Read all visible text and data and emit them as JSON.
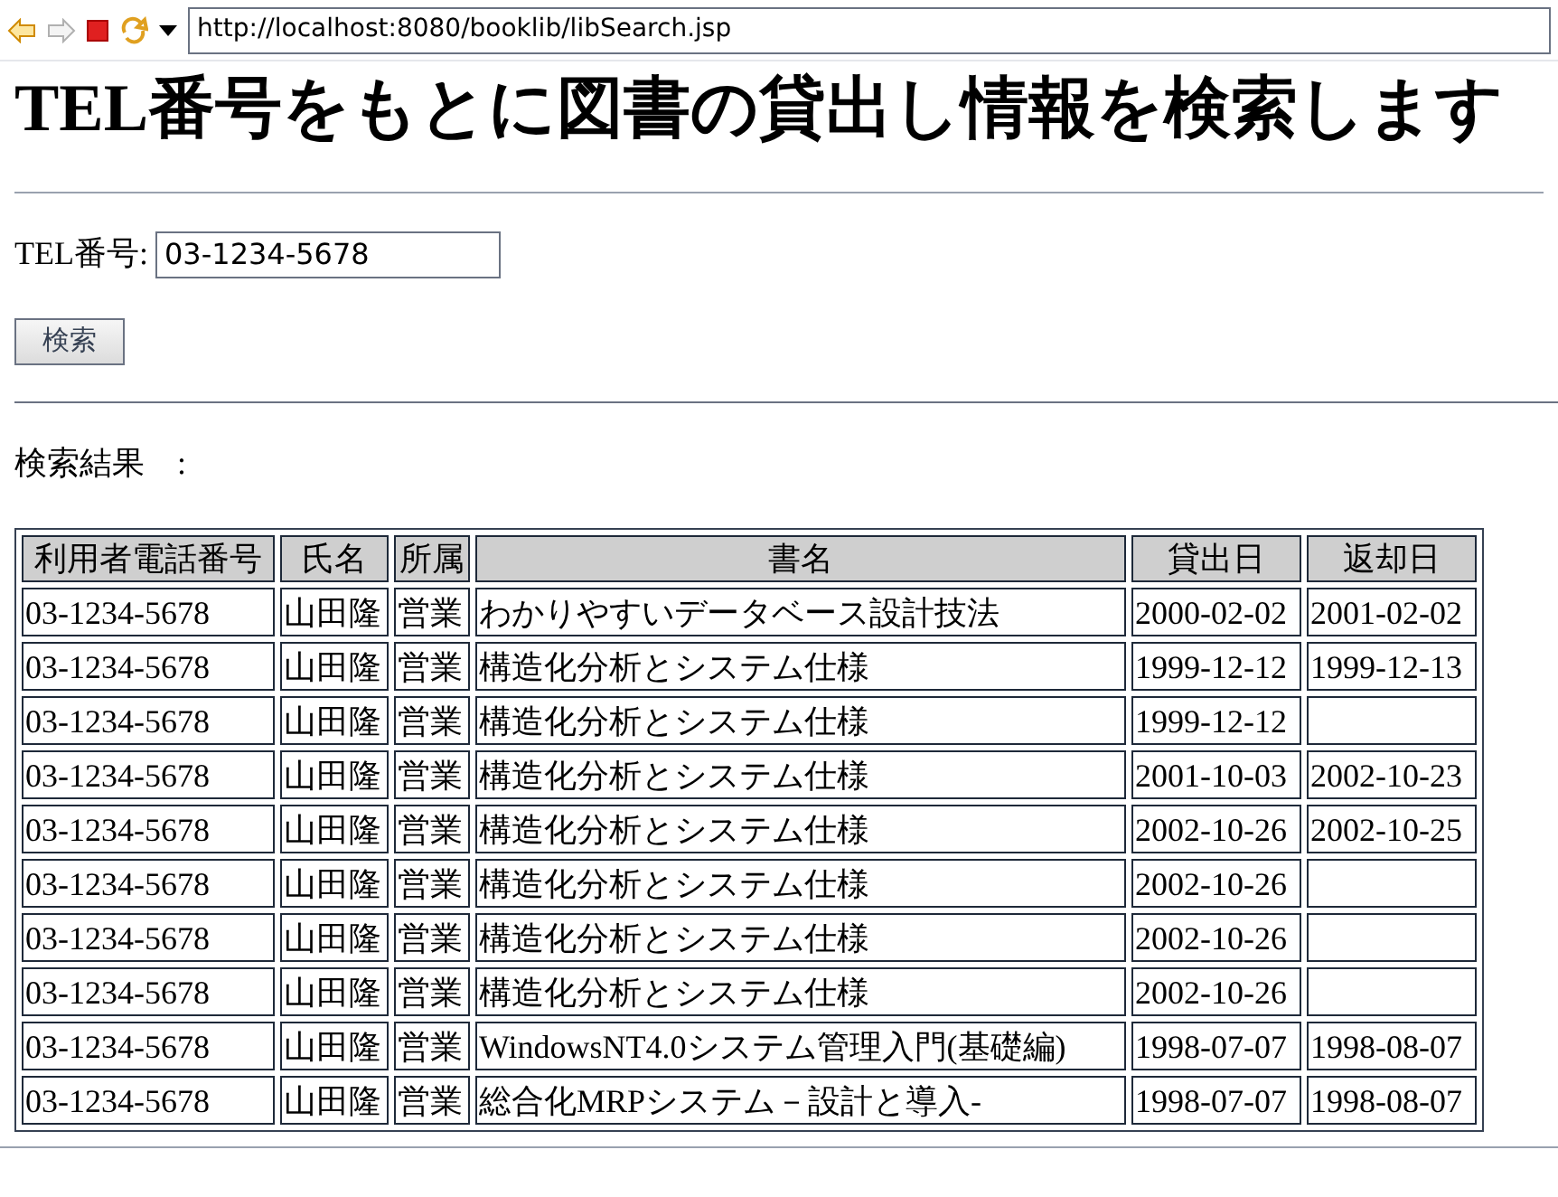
{
  "browser": {
    "url": "http://localhost:8080/booklib/libSearch.jsp"
  },
  "heading": "TEL番号をもとに図書の貸出し情報を検索します",
  "form": {
    "label": "TEL番号:",
    "value": "03-1234-5678",
    "button": "検索"
  },
  "result_label": "検索結果　:",
  "table": {
    "columns": [
      "利用者電話番号",
      "氏名",
      "所属",
      "書名",
      "貸出日",
      "返却日"
    ],
    "rows": [
      [
        "03-1234-5678",
        "山田隆",
        "営業",
        "わかりやすいデータベース設計技法",
        "2000-02-02",
        "2001-02-02"
      ],
      [
        "03-1234-5678",
        "山田隆",
        "営業",
        "構造化分析とシステム仕様",
        "1999-12-12",
        "1999-12-13"
      ],
      [
        "03-1234-5678",
        "山田隆",
        "営業",
        "構造化分析とシステム仕様",
        "1999-12-12",
        ""
      ],
      [
        "03-1234-5678",
        "山田隆",
        "営業",
        "構造化分析とシステム仕様",
        "2001-10-03",
        "2002-10-23"
      ],
      [
        "03-1234-5678",
        "山田隆",
        "営業",
        "構造化分析とシステム仕様",
        "2002-10-26",
        "2002-10-25"
      ],
      [
        "03-1234-5678",
        "山田隆",
        "営業",
        "構造化分析とシステム仕様",
        "2002-10-26",
        ""
      ],
      [
        "03-1234-5678",
        "山田隆",
        "営業",
        "構造化分析とシステム仕様",
        "2002-10-26",
        ""
      ],
      [
        "03-1234-5678",
        "山田隆",
        "営業",
        "構造化分析とシステム仕様",
        "2002-10-26",
        ""
      ],
      [
        "03-1234-5678",
        "山田隆",
        "営業",
        "WindowsNT4.0システム管理入門(基礎編)",
        "1998-07-07",
        "1998-08-07"
      ],
      [
        "03-1234-5678",
        "山田隆",
        "営業",
        "総合化MRPシステム－設計と導入-",
        "1998-07-07",
        "1998-08-07"
      ]
    ]
  }
}
